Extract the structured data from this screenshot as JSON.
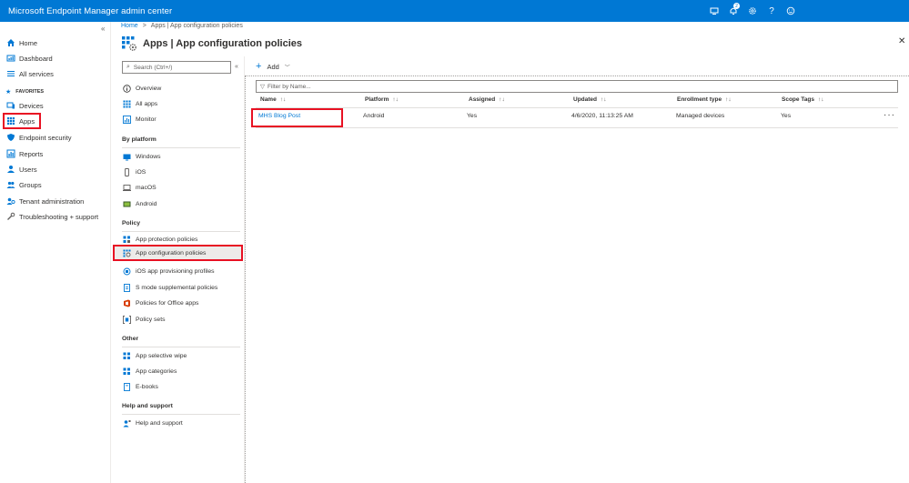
{
  "topbar": {
    "title": "Microsoft Endpoint Manager admin center",
    "notification_count": "2",
    "icons": [
      "screen-icon",
      "bell-icon",
      "gear-icon",
      "help-icon",
      "feedback-icon"
    ]
  },
  "leftnav": {
    "collapse_glyph": "«",
    "items": [
      {
        "label": "Home",
        "icon": "home-icon"
      },
      {
        "label": "Dashboard",
        "icon": "dashboard-icon"
      },
      {
        "label": "All services",
        "icon": "list-icon"
      },
      {
        "label": "Devices",
        "icon": "devices-icon"
      },
      {
        "label": "Apps",
        "icon": "apps-icon"
      },
      {
        "label": "Endpoint security",
        "icon": "shield-icon"
      },
      {
        "label": "Reports",
        "icon": "reports-icon"
      },
      {
        "label": "Users",
        "icon": "user-icon"
      },
      {
        "label": "Groups",
        "icon": "groups-icon"
      },
      {
        "label": "Tenant administration",
        "icon": "tenant-icon"
      },
      {
        "label": "Troubleshooting + support",
        "icon": "wrench-icon"
      }
    ],
    "favorites_label": "FAVORITES"
  },
  "breadcrumb": {
    "home": "Home",
    "separator": ">",
    "current": "Apps | App configuration policies"
  },
  "header": {
    "title": "Apps | App configuration policies",
    "close": "✕"
  },
  "blade": {
    "search_placeholder": "Search (Ctrl+/)",
    "collapse_glyph": "«",
    "items_top": [
      "Overview",
      "All apps",
      "Monitor"
    ],
    "section_platform": "By platform",
    "platform_items": [
      "Windows",
      "iOS",
      "macOS",
      "Android"
    ],
    "section_policy": "Policy",
    "policy_items": [
      "App protection policies",
      "App configuration policies",
      "iOS app provisioning profiles",
      "S mode supplemental policies",
      "Policies for Office apps",
      "Policy sets"
    ],
    "section_other": "Other",
    "other_items": [
      "App selective wipe",
      "App categories",
      "E-books"
    ],
    "section_help": "Help and support",
    "help_items": [
      "Help and support"
    ]
  },
  "toolbar": {
    "add_label": "Add"
  },
  "filter": {
    "placeholder": "Filter by Name..."
  },
  "table": {
    "sort_glyph": "↑↓",
    "columns": [
      "Name",
      "Platform",
      "Assigned",
      "Updated",
      "Enrollment type",
      "Scope Tags"
    ],
    "rows": [
      {
        "name": "MHS Blog Post",
        "platform": "Android",
        "assigned": "Yes",
        "updated": "4/6/2020, 11:13:25 AM",
        "enrollment": "Managed devices",
        "scope": "Yes"
      }
    ],
    "more_glyph": "···"
  },
  "colors": {
    "accent": "#0078d4",
    "highlight": "#e81123"
  }
}
